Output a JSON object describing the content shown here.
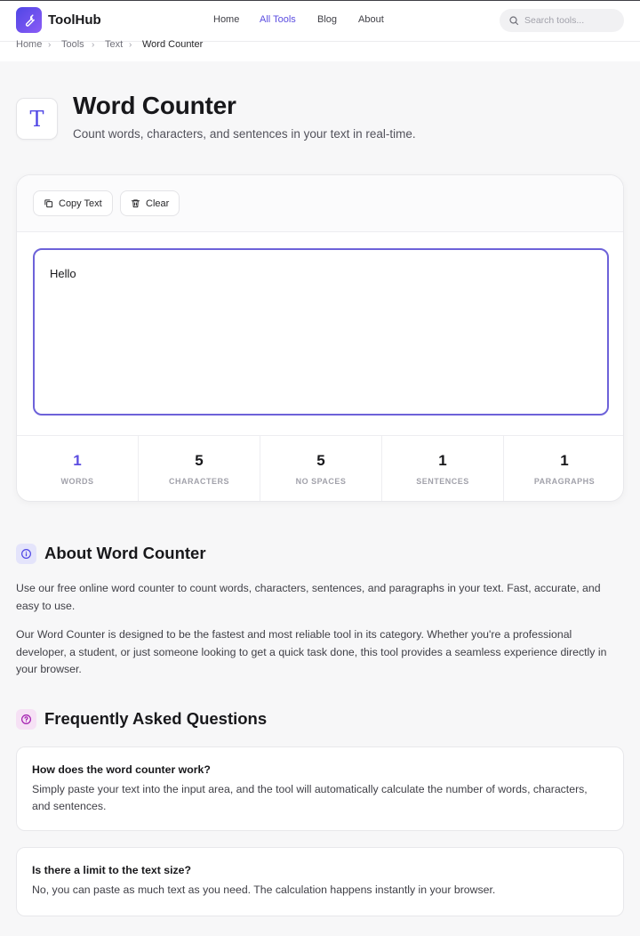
{
  "header": {
    "brand": "ToolHub",
    "nav": [
      {
        "label": "Home",
        "active": false
      },
      {
        "label": "All Tools",
        "active": true
      },
      {
        "label": "Blog",
        "active": false
      },
      {
        "label": "About",
        "active": false
      }
    ],
    "search": {
      "placeholder": "Search tools..."
    }
  },
  "breadcrumb": [
    "Home",
    "Tools",
    "Text",
    "Word Counter"
  ],
  "tool": {
    "icon_letter": "T",
    "title": "Word Counter",
    "subtitle": "Count words, characters, and sentences in your text in real-time."
  },
  "toolbar": {
    "copy_label": "Copy Text",
    "clear_label": "Clear"
  },
  "editor": {
    "value": "Hello"
  },
  "stats": [
    {
      "value": "1",
      "label": "WORDS"
    },
    {
      "value": "5",
      "label": "CHARACTERS"
    },
    {
      "value": "5",
      "label": "NO SPACES"
    },
    {
      "value": "1",
      "label": "SENTENCES"
    },
    {
      "value": "1",
      "label": "PARAGRAPHS"
    }
  ],
  "about": {
    "title": "About Word Counter",
    "p1": "Use our free online word counter to count words, characters, sentences, and paragraphs in your text. Fast, accurate, and easy to use.",
    "p2": "Our Word Counter is designed to be the fastest and most reliable tool in its category. Whether you're a professional developer, a student, or just someone looking to get a quick task done, this tool provides a seamless experience directly in your browser."
  },
  "faq": {
    "title": "Frequently Asked Questions",
    "items": [
      {
        "q": "How does the word counter work?",
        "a": "Simply paste your text into the input area, and the tool will automatically calculate the number of words, characters, and sentences."
      },
      {
        "q": "Is there a limit to the text size?",
        "a": "No, you can paste as much text as you need. The calculation happens instantly in your browser."
      }
    ]
  },
  "colors": {
    "accent": "#5b4de0",
    "about_icon_bg": "#e4e4fb",
    "faq_icon_bg": "#f6e1f5"
  },
  "icons": [
    "wrench-icon",
    "search-icon",
    "chevron-right-icon",
    "copy-icon",
    "trash-icon",
    "info-icon",
    "question-icon"
  ]
}
